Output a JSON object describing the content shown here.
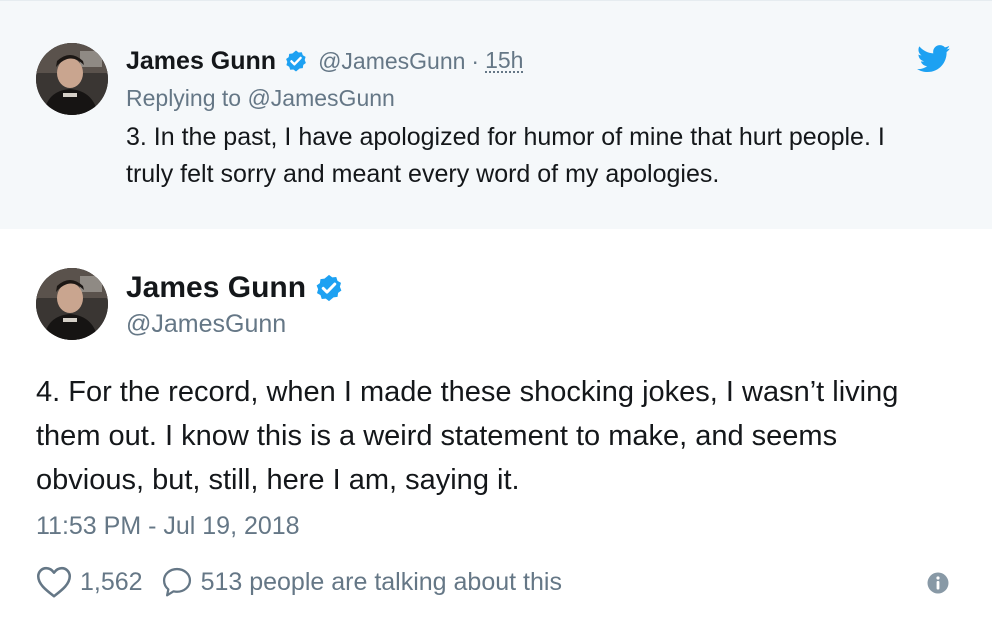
{
  "parent_tweet": {
    "name": "James Gunn",
    "handle": "@JamesGunn",
    "separator": "·",
    "time": "15h",
    "replying_to": "Replying to @JamesGunn",
    "text": "3. In the past, I have apologized for humor of mine that hurt people. I truly felt sorry and meant every word of my apologies."
  },
  "main_tweet": {
    "name": "James Gunn",
    "handle": "@JamesGunn",
    "text": "4. For the record, when I made these shocking jokes, I wasn’t living them out. I know this is a weird statement to make, and seems obvious, but, still, here I am, saying it.",
    "timestamp": "11:53 PM - Jul 19, 2018",
    "likes": "1,562",
    "talking": "513 people are talking about this"
  },
  "icons": {
    "verified": "verified-badge-icon",
    "brand": "twitter-bird-icon",
    "like": "heart-icon",
    "reply": "speech-bubble-icon",
    "info": "info-icon"
  },
  "colors": {
    "accent": "#1da1f2",
    "verified": "#1da1f2",
    "secondary_text": "#657786",
    "primary_text": "#14171a",
    "parent_background": "#f5f8fa"
  }
}
